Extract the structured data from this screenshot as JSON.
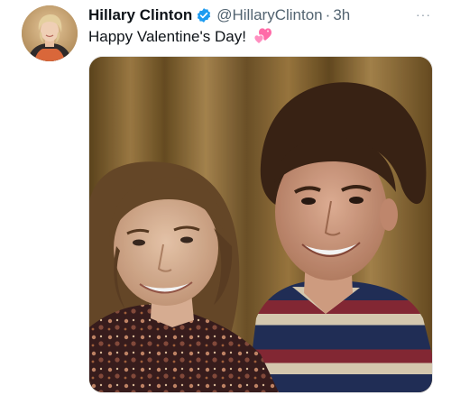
{
  "tweet": {
    "author_name": "Hillary Clinton",
    "handle": "@HillaryClinton",
    "separator": "·",
    "time": "3h",
    "more_label": "···",
    "text": "Happy Valentine's Day!",
    "emoji": "two-hearts",
    "media": {
      "type": "photo"
    }
  },
  "icons": {
    "verified": "verified-badge-icon",
    "more": "more-options-icon"
  },
  "colors": {
    "verified_blue": "#1d9bf0",
    "secondary_text": "#536471",
    "primary_text": "#0f1419",
    "emoji_pink": "#ff6ba8"
  }
}
